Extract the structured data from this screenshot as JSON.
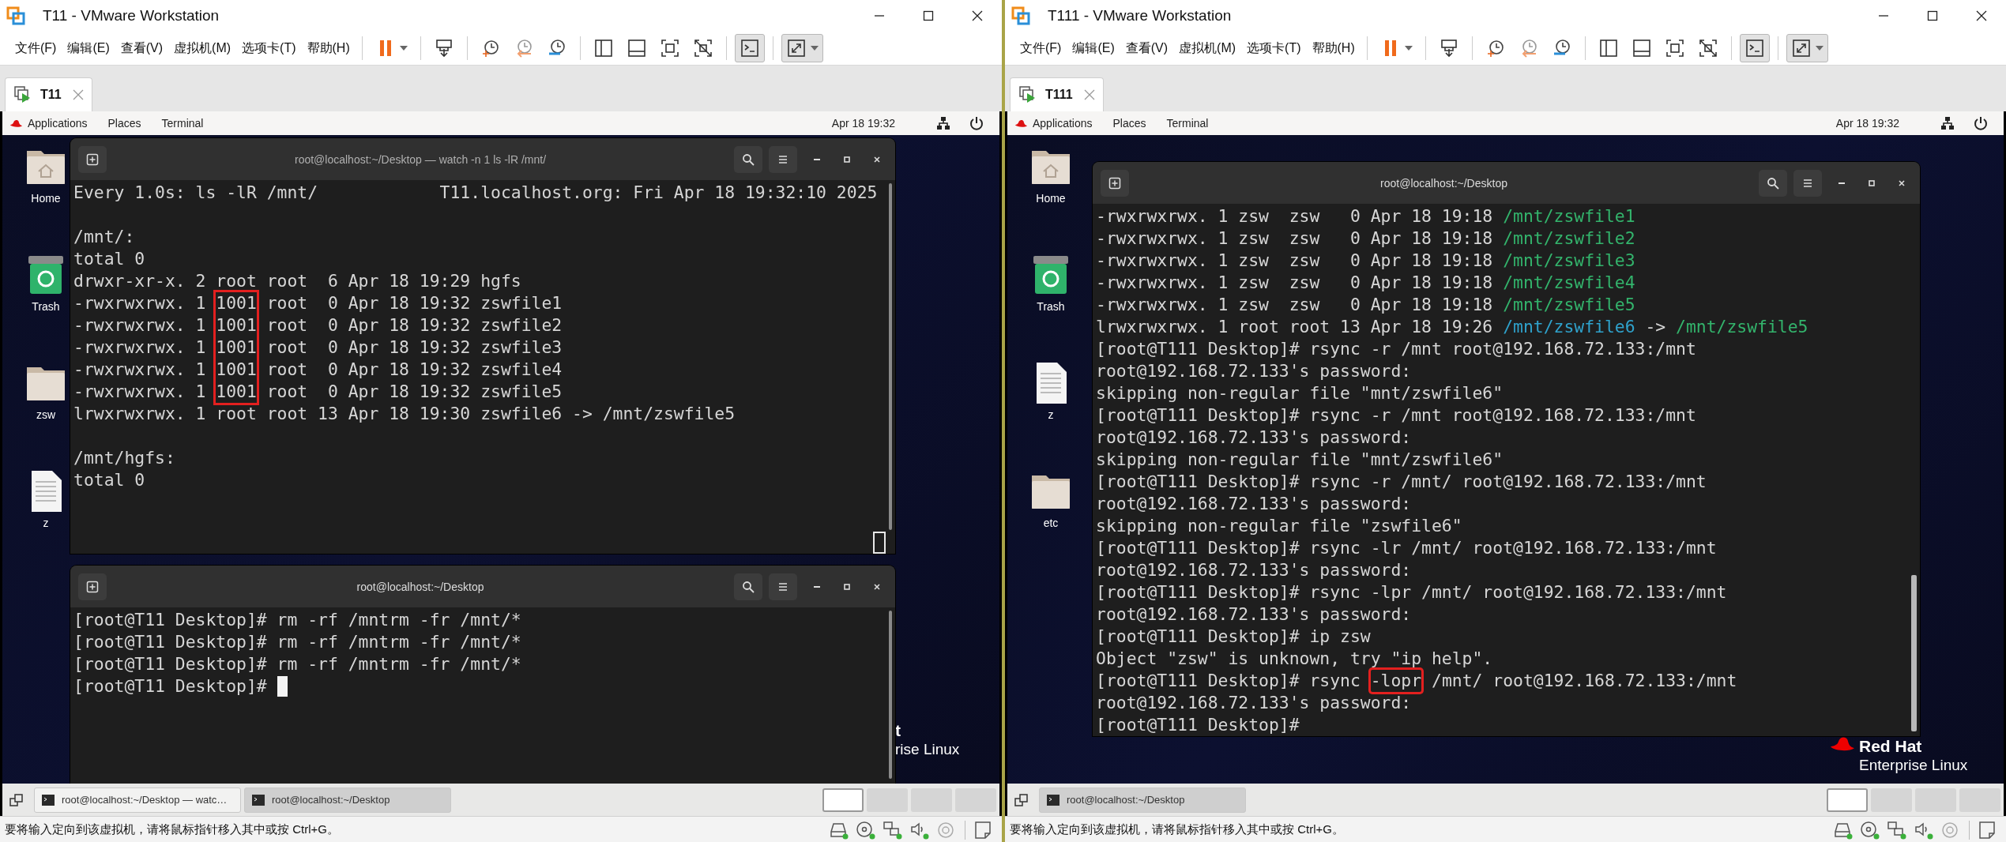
{
  "windows": [
    {
      "title": "T11 - VMware Workstation",
      "menu": [
        "文件(F)",
        "编辑(E)",
        "查看(V)",
        "虚拟机(M)",
        "选项卡(T)",
        "帮助(H)"
      ],
      "toolbar": [
        {
          "kind": "pause",
          "pressed": false
        },
        {
          "kind": "send-keys",
          "pressed": false
        },
        {
          "kind": "snapshot-take",
          "pressed": false
        },
        {
          "kind": "snapshot-revert",
          "pressed": false
        },
        {
          "kind": "snapshot-manager",
          "pressed": false
        },
        {
          "kind": "sidebar",
          "pressed": false
        },
        {
          "kind": "thumbnails",
          "pressed": false
        },
        {
          "kind": "fullscreen",
          "pressed": false
        },
        {
          "kind": "unity",
          "pressed": false
        },
        {
          "kind": "console",
          "pressed": true
        },
        {
          "kind": "stretch",
          "pressed": true
        }
      ],
      "tabs": [
        {
          "label": "T11",
          "selected": true
        }
      ],
      "guest": {
        "top_bar": {
          "items": [
            "Applications",
            "Places",
            "Terminal"
          ],
          "clock": "Apr 18  19:32"
        },
        "desktop_icons": [
          {
            "label": "Home",
            "kind": "home"
          },
          {
            "label": "Trash",
            "kind": "trash"
          },
          {
            "label": "zsw",
            "kind": "folder"
          },
          {
            "label": "z",
            "kind": "document"
          }
        ],
        "branding": {
          "name": "t",
          "product": "rise Linux"
        },
        "terminals": [
          {
            "title": "root@localhost:~/Desktop — watch -n 1 ls -lR /mnt/",
            "cursor": true,
            "focused": false,
            "lines": [
              {
                "kind": "text",
                "segments": [
                  {
                    "kind": "plain",
                    "text": "Every 1.0s: ls -lR /mnt/            T11.localhost.org: Fri Apr 18 19:32:10 2025"
                  }
                ]
              },
              {
                "kind": "blank"
              },
              {
                "kind": "text",
                "segments": [
                  {
                    "kind": "plain",
                    "text": "/mnt/:"
                  }
                ]
              },
              {
                "kind": "text",
                "segments": [
                  {
                    "kind": "plain",
                    "text": "total 0"
                  }
                ]
              },
              {
                "kind": "text",
                "segments": [
                  {
                    "kind": "plain",
                    "text": "drwxr-xr-x. 2 root root  6 Apr 18 19:29 hgfs"
                  }
                ]
              },
              {
                "kind": "text",
                "segments": [
                  {
                    "kind": "plain",
                    "text": "-rwxrwxrwx. 1 "
                  },
                  {
                    "kind": "box-top",
                    "text": "1001"
                  },
                  {
                    "kind": "plain",
                    "text": " root  0 Apr 18 19:32 zswfile1"
                  }
                ]
              },
              {
                "kind": "text",
                "segments": [
                  {
                    "kind": "plain",
                    "text": "-rwxrwxrwx. 1 "
                  },
                  {
                    "kind": "box-mid",
                    "text": "1001"
                  },
                  {
                    "kind": "plain",
                    "text": " root  0 Apr 18 19:32 zswfile2"
                  }
                ]
              },
              {
                "kind": "text",
                "segments": [
                  {
                    "kind": "plain",
                    "text": "-rwxrwxrwx. 1 "
                  },
                  {
                    "kind": "box-mid",
                    "text": "1001"
                  },
                  {
                    "kind": "plain",
                    "text": " root  0 Apr 18 19:32 zswfile3"
                  }
                ]
              },
              {
                "kind": "text",
                "segments": [
                  {
                    "kind": "plain",
                    "text": "-rwxrwxrwx. 1 "
                  },
                  {
                    "kind": "box-mid",
                    "text": "1001"
                  },
                  {
                    "kind": "plain",
                    "text": " root  0 Apr 18 19:32 zswfile4"
                  }
                ]
              },
              {
                "kind": "text",
                "segments": [
                  {
                    "kind": "plain",
                    "text": "-rwxrwxrwx. 1 "
                  },
                  {
                    "kind": "box-bottom",
                    "text": "1001"
                  },
                  {
                    "kind": "plain",
                    "text": " root  0 Apr 18 19:32 zswfile5"
                  }
                ]
              },
              {
                "kind": "text",
                "segments": [
                  {
                    "kind": "plain",
                    "text": "lrwxrwxrwx. 1 root root 13 Apr 18 19:30 zswfile6 -> /mnt/zswfile5"
                  }
                ]
              },
              {
                "kind": "blank"
              },
              {
                "kind": "text",
                "segments": [
                  {
                    "kind": "plain",
                    "text": "/mnt/hgfs:"
                  }
                ]
              },
              {
                "kind": "text",
                "segments": [
                  {
                    "kind": "plain",
                    "text": "total 0"
                  }
                ]
              }
            ]
          },
          {
            "title": "root@localhost:~/Desktop",
            "cursor": true,
            "focused": true,
            "lines": [
              {
                "kind": "text",
                "segments": [
                  {
                    "kind": "plain",
                    "text": "[root@T11 Desktop]# rm -rf /mntrm -fr /mnt/*"
                  }
                ]
              },
              {
                "kind": "text",
                "segments": [
                  {
                    "kind": "plain",
                    "text": "[root@T11 Desktop]# rm -rf /mntrm -fr /mnt/*"
                  }
                ]
              },
              {
                "kind": "text",
                "segments": [
                  {
                    "kind": "plain",
                    "text": "[root@T11 Desktop]# rm -rf /mntrm -fr /mnt/*"
                  }
                ]
              },
              {
                "kind": "text",
                "segments": [
                  {
                    "kind": "plain",
                    "text": "[root@T11 Desktop]# "
                  }
                ]
              }
            ]
          }
        ],
        "taskbar": [
          {
            "label": "root@localhost:~/Desktop — watc…",
            "selected": false
          },
          {
            "label": "root@localhost:~/Desktop",
            "selected": true
          }
        ],
        "workspaces": [
          {
            "selected": true
          },
          {
            "selected": false
          },
          {
            "selected": false
          },
          {
            "selected": false
          }
        ]
      },
      "status": "要将输入定向到该虚拟机，请将鼠标指针移入其中或按 Ctrl+G。",
      "devices": [
        {
          "kind": "hdd",
          "active": true
        },
        {
          "kind": "cd",
          "active": true
        },
        {
          "kind": "network",
          "active": true
        },
        {
          "kind": "sound",
          "active": true
        },
        {
          "kind": "usb",
          "active": false
        }
      ]
    },
    {
      "title": "T111 - VMware Workstation",
      "menu": [
        "文件(F)",
        "编辑(E)",
        "查看(V)",
        "虚拟机(M)",
        "选项卡(T)",
        "帮助(H)"
      ],
      "toolbar": [
        {
          "kind": "pause",
          "pressed": false
        },
        {
          "kind": "send-keys",
          "pressed": false
        },
        {
          "kind": "snapshot-take",
          "pressed": false
        },
        {
          "kind": "snapshot-revert",
          "pressed": false
        },
        {
          "kind": "snapshot-manager",
          "pressed": false
        },
        {
          "kind": "sidebar",
          "pressed": false
        },
        {
          "kind": "thumbnails",
          "pressed": false
        },
        {
          "kind": "fullscreen",
          "pressed": false
        },
        {
          "kind": "unity",
          "pressed": false
        },
        {
          "kind": "console",
          "pressed": true
        },
        {
          "kind": "stretch",
          "pressed": true
        }
      ],
      "tabs": [
        {
          "label": "T111",
          "selected": true
        }
      ],
      "guest": {
        "top_bar": {
          "items": [
            "Applications",
            "Places",
            "Terminal"
          ],
          "clock": "Apr 18  19:32"
        },
        "desktop_icons": [
          {
            "label": "Home",
            "kind": "home"
          },
          {
            "label": "Trash",
            "kind": "trash"
          },
          {
            "label": "z",
            "kind": "document"
          },
          {
            "label": "etc",
            "kind": "folder"
          }
        ],
        "branding": {
          "name": "Red Hat",
          "product": "Enterprise Linux"
        },
        "terminals": [
          {
            "title": "root@localhost:~/Desktop",
            "cursor": false,
            "focused": true,
            "lines": [
              {
                "kind": "text",
                "segments": [
                  {
                    "kind": "plain",
                    "text": "-rwxrwxrwx. 1 zsw  zsw   0 Apr 18 19:18 "
                  },
                  {
                    "kind": "exec",
                    "text": "/mnt/zswfile1"
                  }
                ]
              },
              {
                "kind": "text",
                "segments": [
                  {
                    "kind": "plain",
                    "text": "-rwxrwxrwx. 1 zsw  zsw   0 Apr 18 19:18 "
                  },
                  {
                    "kind": "exec",
                    "text": "/mnt/zswfile2"
                  }
                ]
              },
              {
                "kind": "text",
                "segments": [
                  {
                    "kind": "plain",
                    "text": "-rwxrwxrwx. 1 zsw  zsw   0 Apr 18 19:18 "
                  },
                  {
                    "kind": "exec",
                    "text": "/mnt/zswfile3"
                  }
                ]
              },
              {
                "kind": "text",
                "segments": [
                  {
                    "kind": "plain",
                    "text": "-rwxrwxrwx. 1 zsw  zsw   0 Apr 18 19:18 "
                  },
                  {
                    "kind": "exec",
                    "text": "/mnt/zswfile4"
                  }
                ]
              },
              {
                "kind": "text",
                "segments": [
                  {
                    "kind": "plain",
                    "text": "-rwxrwxrwx. 1 zsw  zsw   0 Apr 18 19:18 "
                  },
                  {
                    "kind": "exec",
                    "text": "/mnt/zswfile5"
                  }
                ]
              },
              {
                "kind": "text",
                "segments": [
                  {
                    "kind": "plain",
                    "text": "lrwxrwxrwx. 1 root root 13 Apr 18 19:26 "
                  },
                  {
                    "kind": "link",
                    "text": "/mnt/zswfile6"
                  },
                  {
                    "kind": "plain",
                    "text": " -> "
                  },
                  {
                    "kind": "exec",
                    "text": "/mnt/zswfile5"
                  }
                ]
              },
              {
                "kind": "text",
                "segments": [
                  {
                    "kind": "plain",
                    "text": "[root@T111 Desktop]# rsync -r /mnt root@192.168.72.133:/mnt"
                  }
                ]
              },
              {
                "kind": "text",
                "segments": [
                  {
                    "kind": "plain",
                    "text": "root@192.168.72.133's password:"
                  }
                ]
              },
              {
                "kind": "text",
                "segments": [
                  {
                    "kind": "plain",
                    "text": "skipping non-regular file \"mnt/zswfile6\""
                  }
                ]
              },
              {
                "kind": "text",
                "segments": [
                  {
                    "kind": "plain",
                    "text": "[root@T111 Desktop]# rsync -r /mnt root@192.168.72.133:/mnt"
                  }
                ]
              },
              {
                "kind": "text",
                "segments": [
                  {
                    "kind": "plain",
                    "text": "root@192.168.72.133's password:"
                  }
                ]
              },
              {
                "kind": "text",
                "segments": [
                  {
                    "kind": "plain",
                    "text": "skipping non-regular file \"mnt/zswfile6\""
                  }
                ]
              },
              {
                "kind": "text",
                "segments": [
                  {
                    "kind": "plain",
                    "text": "[root@T111 Desktop]# rsync -r /mnt/ root@192.168.72.133:/mnt"
                  }
                ]
              },
              {
                "kind": "text",
                "segments": [
                  {
                    "kind": "plain",
                    "text": "root@192.168.72.133's password:"
                  }
                ]
              },
              {
                "kind": "text",
                "segments": [
                  {
                    "kind": "plain",
                    "text": "skipping non-regular file \"zswfile6\""
                  }
                ]
              },
              {
                "kind": "text",
                "segments": [
                  {
                    "kind": "plain",
                    "text": "[root@T111 Desktop]# rsync -lr /mnt/ root@192.168.72.133:/mnt"
                  }
                ]
              },
              {
                "kind": "text",
                "segments": [
                  {
                    "kind": "plain",
                    "text": "root@192.168.72.133's password:"
                  }
                ]
              },
              {
                "kind": "text",
                "segments": [
                  {
                    "kind": "plain",
                    "text": "[root@T111 Desktop]# rsync -lpr /mnt/ root@192.168.72.133:/mnt"
                  }
                ]
              },
              {
                "kind": "text",
                "segments": [
                  {
                    "kind": "plain",
                    "text": "root@192.168.72.133's password:"
                  }
                ]
              },
              {
                "kind": "text",
                "segments": [
                  {
                    "kind": "plain",
                    "text": "[root@T111 Desktop]# ip zsw"
                  }
                ]
              },
              {
                "kind": "text",
                "segments": [
                  {
                    "kind": "plain",
                    "text": "Object \"zsw\" is unknown, try \"ip help\"."
                  }
                ]
              },
              {
                "kind": "text",
                "segments": [
                  {
                    "kind": "plain",
                    "text": "[root@T111 Desktop]# rsync "
                  },
                  {
                    "kind": "box",
                    "text": "-lopr"
                  },
                  {
                    "kind": "plain",
                    "text": " /mnt/ root@192.168.72.133:/mnt"
                  }
                ]
              },
              {
                "kind": "text",
                "segments": [
                  {
                    "kind": "plain",
                    "text": "root@192.168.72.133's password:"
                  }
                ]
              },
              {
                "kind": "text",
                "segments": [
                  {
                    "kind": "plain",
                    "text": "[root@T111 Desktop]#"
                  }
                ]
              }
            ]
          }
        ],
        "taskbar": [
          {
            "label": "root@localhost:~/Desktop",
            "selected": true
          }
        ],
        "workspaces": [
          {
            "selected": true
          },
          {
            "selected": false
          },
          {
            "selected": false
          },
          {
            "selected": false
          }
        ]
      },
      "status": "要将输入定向到该虚拟机，请将鼠标指针移入其中或按 Ctrl+G。",
      "devices": [
        {
          "kind": "hdd",
          "active": true
        },
        {
          "kind": "cd",
          "active": true
        },
        {
          "kind": "network",
          "active": true
        },
        {
          "kind": "sound",
          "active": true
        },
        {
          "kind": "usb",
          "active": false
        }
      ]
    }
  ]
}
